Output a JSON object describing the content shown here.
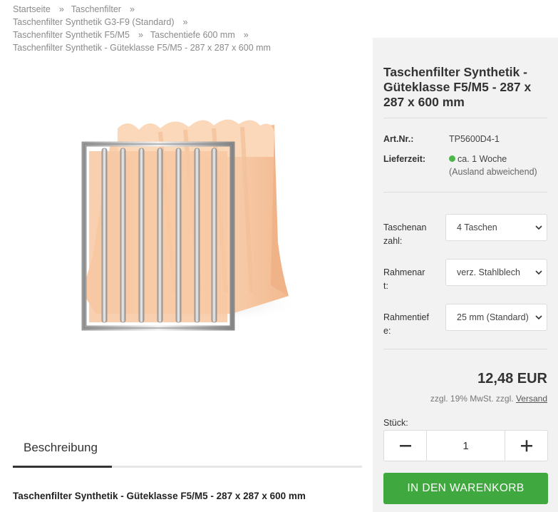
{
  "breadcrumb": {
    "items": [
      "Startseite",
      "Taschenfilter",
      "Taschenfilter Synthetik G3-F9 (Standard)",
      "Taschenfilter Synthetik F5/M5",
      "Taschentiefe 600 mm"
    ],
    "current": "Taschenfilter Synthetik - Güteklasse F5/M5 - 287 x 287 x 600 mm",
    "separator": "»"
  },
  "product": {
    "title": "Taschenfilter Synthetik - Güteklasse F5/M5 - 287 x 287 x 600 mm",
    "art_nr_label": "Art.Nr.:",
    "art_nr": "TP5600D4-1",
    "delivery_label": "Lieferzeit:",
    "delivery_value": "ca. 1 Woche",
    "delivery_note": "(Ausland abweichend)",
    "delivery_status_color": "#4cb748"
  },
  "options": [
    {
      "label": "Taschenanzahl:",
      "value": "4 Taschen"
    },
    {
      "label": "Rahmenart:",
      "value": "verz. Stahlblech"
    },
    {
      "label": "Rahmentiefe:",
      "value": "25 mm (Standard)"
    }
  ],
  "price": {
    "value": "12,48 EUR",
    "tax_text": "zzgl. 19% MwSt. zzgl.",
    "shipping_link": "Versand"
  },
  "quantity": {
    "label": "Stück:",
    "value": "1",
    "minus_icon": "minus-icon",
    "plus_icon": "plus-icon"
  },
  "cart": {
    "label": "IN DEN WARENKORB",
    "color": "#3fa93f"
  },
  "tabs": {
    "description": "Beschreibung"
  },
  "description": {
    "title": "Taschenfilter Synthetik - Güteklasse F5/M5 - 287 x 287 x 600 mm"
  }
}
